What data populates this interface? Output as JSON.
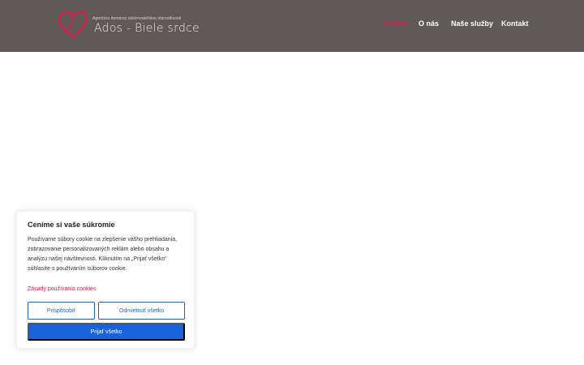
{
  "header": {
    "logo": {
      "tagline": "Agentúra domácej ošetrovateľskej starostlivosti",
      "name": "Ados - Biele srdce"
    },
    "nav": [
      {
        "label": "Domov",
        "active": true
      },
      {
        "label": "O nás",
        "active": false
      },
      {
        "label": "Naše služby",
        "active": false
      },
      {
        "label": "Kontakt",
        "active": false
      }
    ]
  },
  "cookie_banner": {
    "title": "Ceníme si vaše súkromie",
    "text": "Používame súbory cookie na zlepšenie vášho prehliadania, zobrazovanie personalizovaných reklám alebo obsahu a analýzu našej návštevnosti. Kliknutím na „Prijať všetko“ súhlasíte s používaním súborov cookie.",
    "policy_link": "Zásady používania cookies",
    "customize_label": "Prispôsobiť",
    "reject_label": "Odmietnuť všetko",
    "accept_label": "Prijať všetko"
  },
  "colors": {
    "header_bg": "#5f5958",
    "accent": "#d91a4c",
    "button_blue": "#1863dc"
  },
  "icons": {
    "logo": "heart-icon"
  }
}
